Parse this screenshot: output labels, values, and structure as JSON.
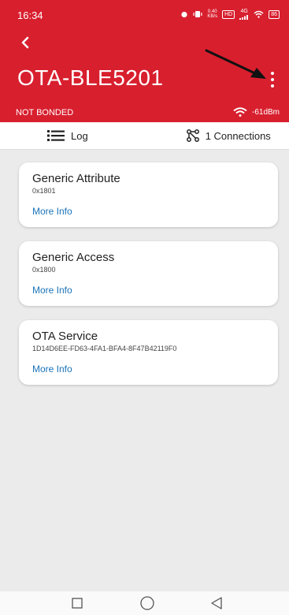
{
  "status_bar": {
    "time": "16:34",
    "net_speed_value": "0.40",
    "net_speed_unit": "KB/s",
    "hd_label": "HD",
    "network_label": "4G",
    "battery_label": "86"
  },
  "header": {
    "title": "OTA-BLE5201",
    "bond_state": "NOT BONDED",
    "rssi": "-61dBm"
  },
  "tabs": [
    {
      "label": "Log",
      "icon": "list-icon"
    },
    {
      "label": "1 Connections",
      "icon": "network-icon"
    }
  ],
  "services": [
    {
      "name": "Generic Attribute",
      "uuid": "0x1801",
      "link": "More Info"
    },
    {
      "name": "Generic Access",
      "uuid": "0x1800",
      "link": "More Info"
    },
    {
      "name": "OTA Service",
      "uuid": "1D14D6EE-FD63-4FA1-BFA4-8F47B42119F0",
      "link": "More Info"
    }
  ],
  "colors": {
    "header_bg": "#d81f2e",
    "link": "#1a73b8",
    "background": "#ebebeb"
  }
}
